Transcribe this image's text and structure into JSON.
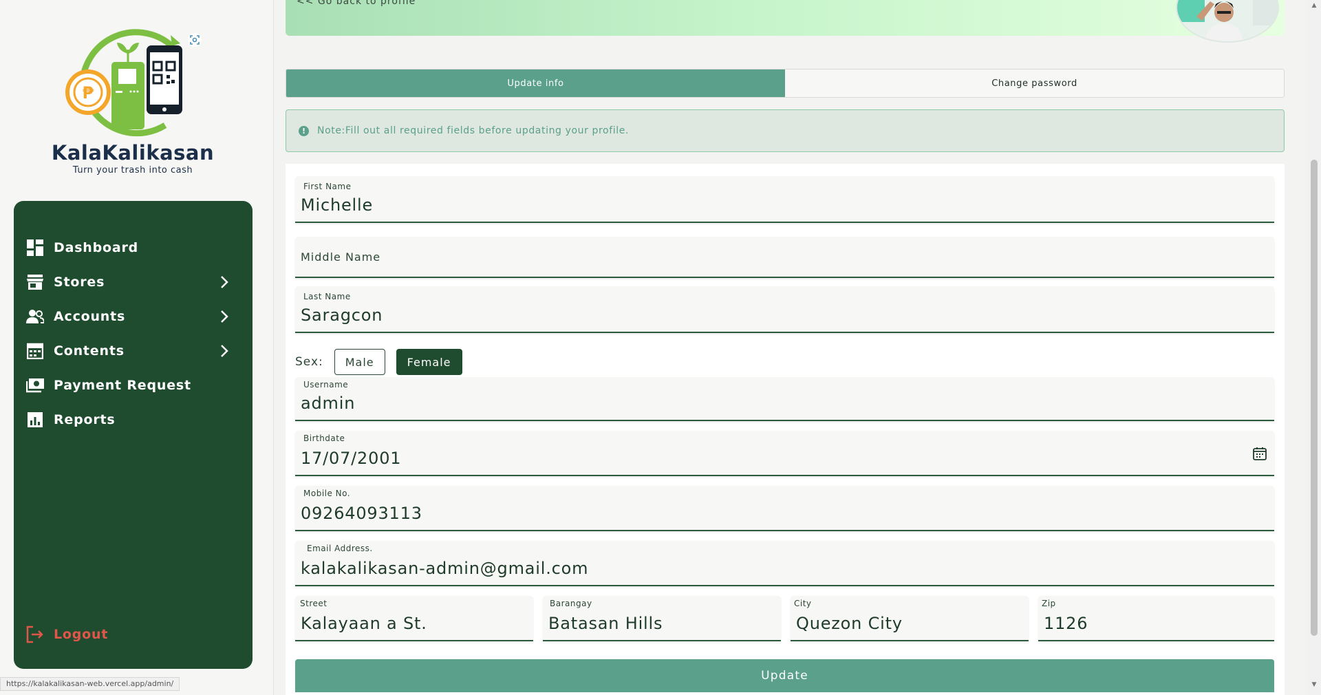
{
  "brand": {
    "name": "KalaKalikasan",
    "tagline": "Turn your trash into cash",
    "coin_symbol": "₱"
  },
  "sidebar": {
    "items": [
      {
        "label": "Dashboard",
        "icon": "dashboard-icon",
        "has_submenu": false
      },
      {
        "label": "Stores",
        "icon": "store-icon",
        "has_submenu": true
      },
      {
        "label": "Accounts",
        "icon": "accounts-icon",
        "has_submenu": true
      },
      {
        "label": "Contents",
        "icon": "contents-icon",
        "has_submenu": true
      },
      {
        "label": "Payment Request",
        "icon": "payment-icon",
        "has_submenu": false
      },
      {
        "label": "Reports",
        "icon": "reports-icon",
        "has_submenu": false
      }
    ],
    "logout_label": "Logout"
  },
  "status_url": "https://kalakalikasan-web.vercel.app/admin/",
  "header": {
    "back_link": "<< Go back to profile"
  },
  "tabs": [
    {
      "label": "Update info",
      "active": true
    },
    {
      "label": "Change password",
      "active": false
    }
  ],
  "note": {
    "text": "Note:Fill out all required fields before updating your profile."
  },
  "form": {
    "first_name": {
      "label": "First Name",
      "value": "Michelle"
    },
    "middle_name": {
      "label": "Middle Name",
      "value": ""
    },
    "last_name": {
      "label": "Last Name",
      "value": "Saragcon"
    },
    "sex": {
      "label": "Sex:",
      "options": [
        "Male",
        "Female"
      ],
      "selected": "Female"
    },
    "username": {
      "label": "Username",
      "value": "admin"
    },
    "birthdate": {
      "label": "Birthdate",
      "value": "17/07/2001"
    },
    "mobile": {
      "label": "Mobile No.",
      "value": "09264093113"
    },
    "email": {
      "label": "Email Address.",
      "value": "kalakalikasan-admin@gmail.com"
    },
    "street": {
      "label": "Street",
      "value": "Kalayaan a St."
    },
    "barangay": {
      "label": "Barangay",
      "value": "Batasan Hills"
    },
    "city": {
      "label": "City",
      "value": "Quezon City"
    },
    "zip": {
      "label": "Zip",
      "value": "1126"
    },
    "submit_label": "Update"
  },
  "colors": {
    "nav_bg": "#1f4b2f",
    "accent": "#5aa08b",
    "logout": "#e0574a",
    "brand_green": "#7cbf42",
    "coin_orange": "#f4a62a"
  }
}
